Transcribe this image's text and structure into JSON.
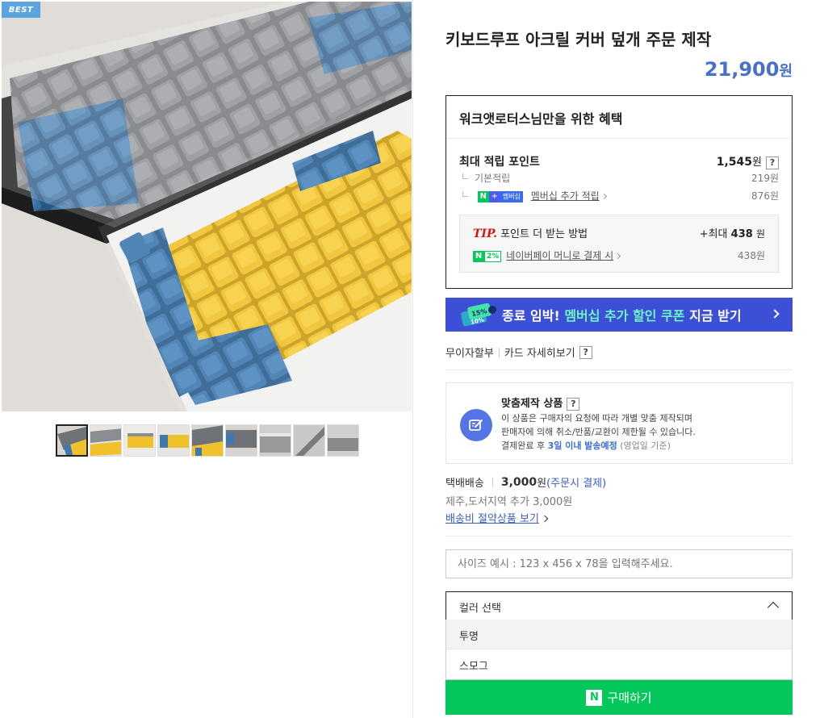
{
  "gallery": {
    "badge": "BEST",
    "thumb_count": 9
  },
  "product": {
    "title": "키보드루프 아크릴 커버 덮개 주문 제작",
    "price": "21,900",
    "price_unit": "원"
  },
  "benefit": {
    "heading": "워크앳로터스님만을 위한 혜택",
    "max_points_label": "최대 적립 포인트",
    "max_points_value": "1,545",
    "unit": "원",
    "help": "?",
    "basic_label": "기본적립",
    "basic_value": "219원",
    "membership_badge_n": "N",
    "membership_badge_plus": "+",
    "membership_badge_text": "멤버십",
    "membership_label": "멤버십 추가 적립",
    "membership_value": "876원",
    "tip_label": "TIP.",
    "tip_text": "포인트 더 받는 방법",
    "tip_value_prefix": "+최대",
    "tip_value": "438",
    "tip_unit": "원",
    "npay_badge_n": "N",
    "npay_badge_pct": "2%",
    "npay_label": "네이버페이 머니로 결제 시",
    "npay_value": "438원"
  },
  "banner": {
    "text_before": "종료 임박! ",
    "text_highlight": "멤버십 추가 할인 쿠폰",
    "text_after": " 지금 받기",
    "coupon_pct1": "15%",
    "coupon_pct2": "10%"
  },
  "payment": {
    "installment": "무이자할부",
    "card_details": "카드 자세히보기",
    "help": "?"
  },
  "custom": {
    "title": "맞춤제작 상품",
    "help": "?",
    "line1": "이 상품은 구매자의 요청에 따라 개별 맞춤 제작되며",
    "line2": "판매자에 의해 취소/반품/교환이 제한될 수 있습니다.",
    "line3_prefix": "결제완료 후 ",
    "line3_highlight": "3일 이내 발송예정",
    "line3_suffix": " (영업일 기준)"
  },
  "shipping": {
    "method": "택배배송",
    "fee": "3,000",
    "fee_unit": "원",
    "fee_note": "(주문시 결제)",
    "extra": "제주,도서지역 추가 3,000원",
    "saving_link": "배송비 절약상품 보기"
  },
  "size_input": {
    "placeholder": "사이즈 예시 : 123 x 456 x 78을 입력해주세요."
  },
  "color_select": {
    "label": "컬러 선택",
    "options": [
      "투명",
      "스모그"
    ]
  },
  "buy": {
    "logo": "N",
    "label": "구매하기"
  },
  "colors": {
    "price_blue": "#4a70c8",
    "banner_bg": "#3c50d7",
    "banner_highlight": "#6df6c3",
    "naver_green": "#03c75a",
    "link_blue": "#3b5fc4"
  }
}
